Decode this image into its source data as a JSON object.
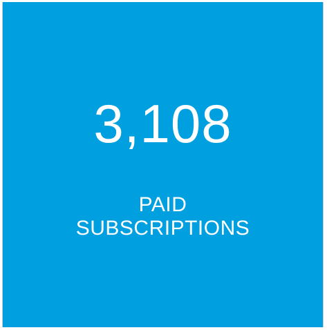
{
  "stat_tile": {
    "value": "3,108",
    "label_line1": "PAID",
    "label_line2": "SUBSCRIPTIONS",
    "background_color": "#009fdf",
    "text_color": "#ffffff"
  }
}
